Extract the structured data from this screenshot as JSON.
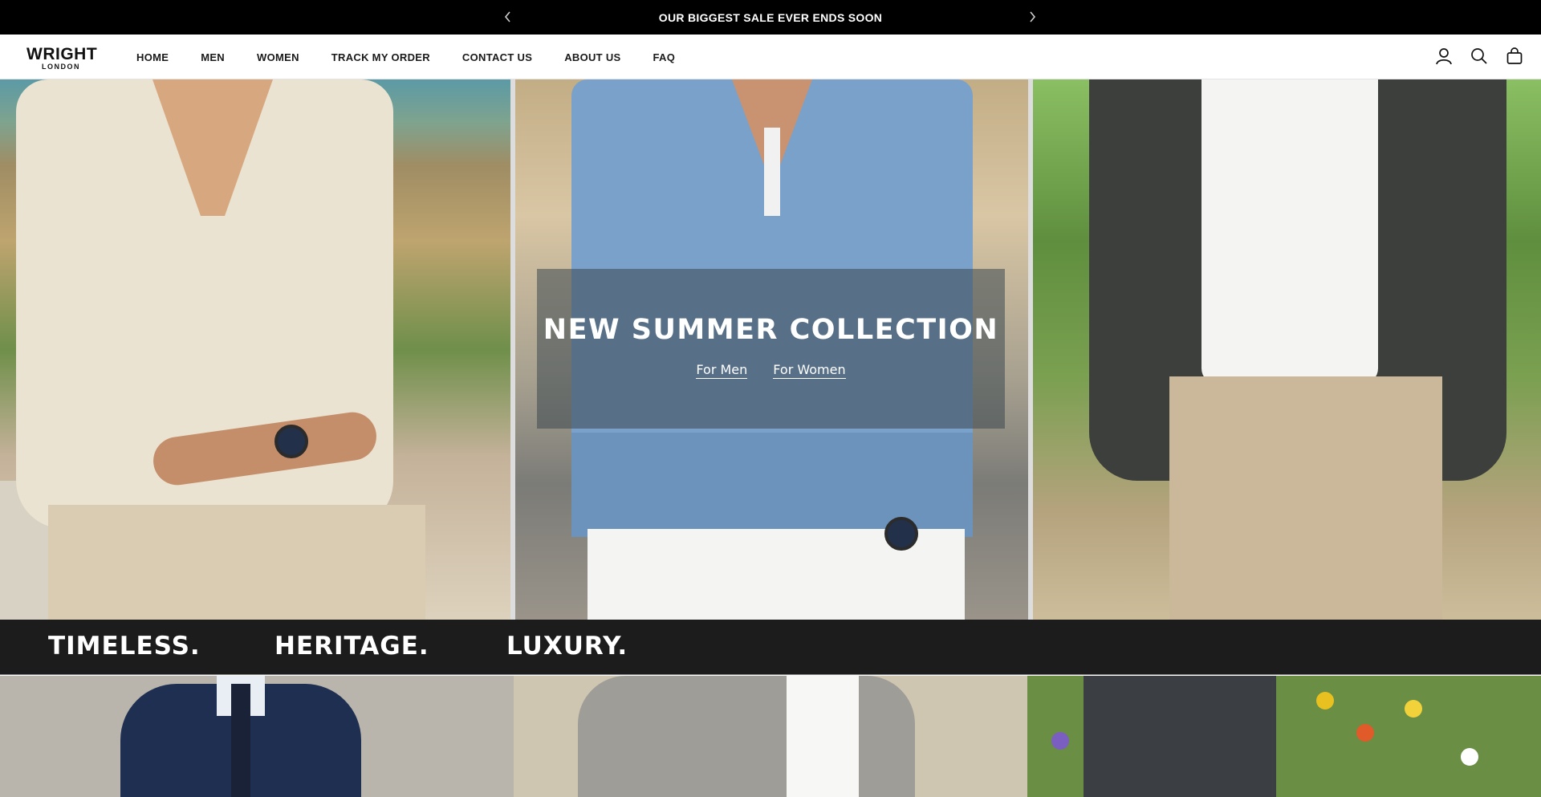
{
  "announcement": {
    "text": "OUR BIGGEST SALE EVER ENDS SOON",
    "prev_icon": "chevron-left-icon",
    "next_icon": "chevron-right-icon"
  },
  "header": {
    "logo": {
      "line1": "WRIGHT",
      "line2": "LONDON"
    },
    "nav": [
      {
        "label": "HOME"
      },
      {
        "label": "MEN"
      },
      {
        "label": "WOMEN"
      },
      {
        "label": "TRACK MY ORDER"
      },
      {
        "label": "CONTACT US"
      },
      {
        "label": "ABOUT US"
      },
      {
        "label": "FAQ"
      }
    ],
    "icons": [
      "account-icon",
      "search-icon",
      "cart-bag-icon"
    ]
  },
  "hero": {
    "title": "NEW SUMMER COLLECTION",
    "links": [
      {
        "label": "For Men"
      },
      {
        "label": "For Women"
      }
    ]
  },
  "taglines": [
    "TIMELESS.",
    "HERITAGE.",
    "LUXURY."
  ],
  "colors": {
    "announcement_bg": "#000000",
    "strip_bg": "#1c1c1c",
    "header_bg": "#ffffff"
  }
}
